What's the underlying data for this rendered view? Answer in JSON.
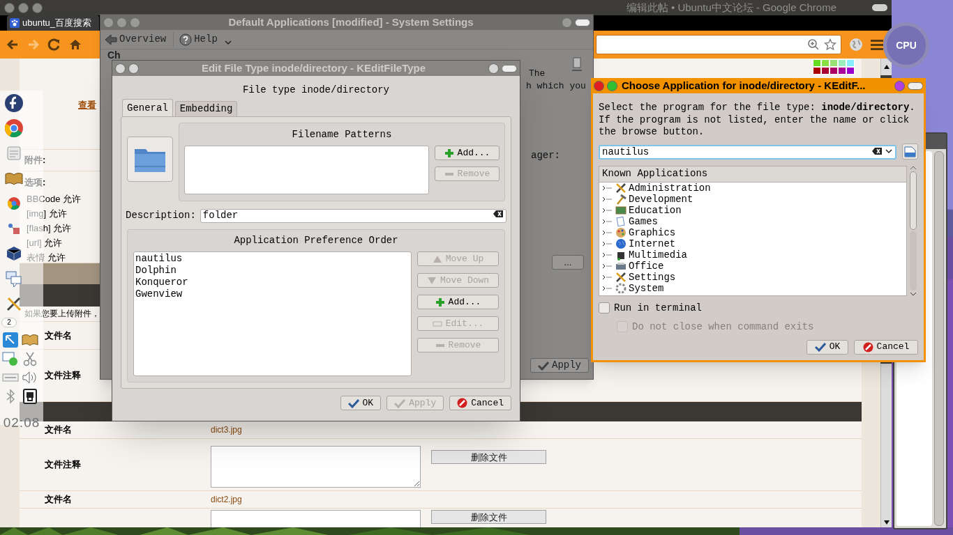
{
  "browser": {
    "title": "编辑此帖 • Ubuntu中文论坛 - Google Chrome",
    "tab": "ubuntu_百度搜索",
    "page": {
      "link": "查看",
      "attach_label": "附件:",
      "options_label": "选项:",
      "options": [
        "BBCode 允许",
        "[img] 允许",
        "[flash] 允许",
        "[url] 允许",
        "表情 允许"
      ],
      "upload_hint": "如果您要上传附件，",
      "upload_rows": [
        "文件名",
        "文件注释"
      ],
      "files": [
        {
          "name_label": "文件名",
          "file": "dict3.jpg",
          "comment_label": "文件注释",
          "delete": "删除文件"
        },
        {
          "name_label": "文件名",
          "file": "dict2.jpg",
          "delete": "删除文件"
        }
      ]
    }
  },
  "launcher": {
    "pager": "2",
    "clock": "02:08"
  },
  "cpu_widget": {
    "label": "CPU"
  },
  "settings_window": {
    "title": "Default Applications [modified] - System Settings",
    "toolbar": [
      "Overview",
      "Help"
    ],
    "fragments": [
      "Ch",
      "The",
      "h which you",
      "ager:"
    ],
    "more_button": "...",
    "apply": "Apply"
  },
  "edit_window": {
    "title": "Edit File Type inode/directory - KEditFileType",
    "heading": "File type inode/directory",
    "tabs": [
      {
        "label": "General",
        "selected": true
      },
      {
        "label": "Embedding",
        "selected": false
      }
    ],
    "patterns": {
      "title": "Filename Patterns",
      "buttons": [
        {
          "label": "Add...",
          "kind": "add",
          "disabled": false
        },
        {
          "label": "Remove",
          "kind": "remove",
          "disabled": true
        }
      ]
    },
    "description": {
      "label": "Description:",
      "value": "folder"
    },
    "preference": {
      "title": "Application Preference Order",
      "apps": [
        "nautilus",
        "Dolphin",
        "Konqueror",
        "Gwenview"
      ],
      "buttons": [
        {
          "label": "Move Up",
          "kind": "up",
          "disabled": true
        },
        {
          "label": "Move Down",
          "kind": "down",
          "disabled": true
        },
        {
          "label": "Add...",
          "kind": "add",
          "disabled": false
        },
        {
          "label": "Edit...",
          "kind": "edit",
          "disabled": true
        },
        {
          "label": "Remove",
          "kind": "remove",
          "disabled": true
        }
      ]
    },
    "buttons": [
      {
        "label": "OK",
        "kind": "ok",
        "disabled": false
      },
      {
        "label": "Apply",
        "kind": "ok",
        "disabled": true
      },
      {
        "label": "Cancel",
        "kind": "cancel",
        "disabled": false
      }
    ]
  },
  "choose_dialog": {
    "title": "Choose Application for inode/directory - KEditF...",
    "prompt": "Select the program for the file type: **inode/directory**.\nIf the program is not listed, enter the name or click the browse button.",
    "input": "nautilus",
    "tree_header": "Known Applications",
    "categories": [
      "Administration",
      "Development",
      "Education",
      "Games",
      "Graphics",
      "Internet",
      "Multimedia",
      "Office",
      "Settings",
      "System"
    ],
    "options": [
      {
        "label": "Run in terminal",
        "checked": false,
        "disabled": false
      },
      {
        "label": "Do not close when command exits",
        "checked": false,
        "disabled": true
      }
    ],
    "buttons": [
      {
        "label": "OK",
        "kind": "ok",
        "disabled": false
      },
      {
        "label": "Cancel",
        "kind": "cancel",
        "disabled": false
      }
    ]
  }
}
